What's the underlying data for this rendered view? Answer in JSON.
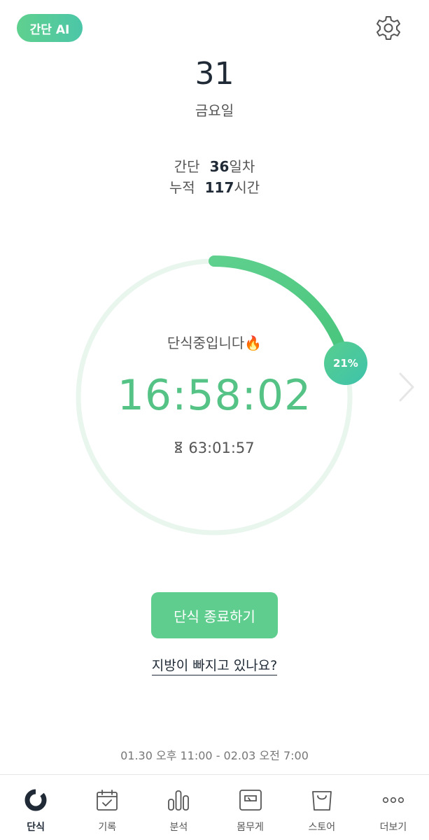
{
  "header": {
    "ai_badge": "간단 AI"
  },
  "date": {
    "day_number": "31",
    "weekday": "금요일"
  },
  "stats": {
    "day_label": "간단",
    "day_value": "36",
    "day_unit": "일차",
    "total_label": "누적",
    "total_value": "117",
    "total_unit": "시간"
  },
  "fasting": {
    "status_text": "단식중입니다🔥",
    "elapsed": "16:58:02",
    "remaining": "63:01:57",
    "progress_label": "21%",
    "progress_fraction": 0.21
  },
  "actions": {
    "end_button": "단식 종료하기",
    "fat_link": "지방이 빠지고 있나요?"
  },
  "schedule": {
    "range": "01.30 오후 11:00 - 02.03 오전 7:00"
  },
  "tabs": [
    {
      "label": "단식",
      "icon": "fasting-ring-icon",
      "active": true
    },
    {
      "label": "기록",
      "icon": "calendar-check-icon"
    },
    {
      "label": "분석",
      "icon": "bar-chart-icon"
    },
    {
      "label": "몸무게",
      "icon": "scale-icon"
    },
    {
      "label": "스토어",
      "icon": "shopping-bag-icon"
    },
    {
      "label": "더보기",
      "icon": "more-icon"
    }
  ],
  "colors": {
    "accent": "#5fcd8d",
    "ring_track": "#e8f6ee",
    "text_dark": "#1f2a36"
  }
}
